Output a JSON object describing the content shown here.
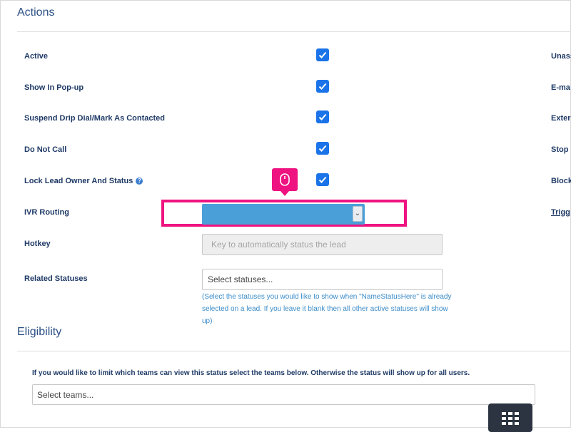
{
  "sections": {
    "actions_title": "Actions",
    "eligibility_title": "Eligibility"
  },
  "rows": {
    "active": "Active",
    "show_in_popup": "Show In Pop-up",
    "suspend_drip": "Suspend Drip Dial/Mark As Contacted",
    "do_not_call": "Do Not Call",
    "lock_lead_owner": "Lock Lead Owner And Status",
    "ivr_routing": "IVR Routing",
    "hotkey": "Hotkey",
    "related_statuses": "Related Statuses"
  },
  "checkboxes": {
    "active": true,
    "show_in_popup": true,
    "suspend_drip": true,
    "do_not_call": true,
    "lock_lead_owner": true
  },
  "right_column": {
    "row1": "Unass",
    "row2": "E-ma",
    "row3": "Exter",
    "row4": "Stop l",
    "row5": "Block",
    "row6": "Trigg"
  },
  "ivr_select": {
    "value": ""
  },
  "hotkey_input": {
    "placeholder": "Key to automatically status the lead"
  },
  "related_statuses_input": {
    "placeholder": "Select statuses..."
  },
  "related_statuses_help": "(Select the statuses you would like to show when \"NameStatusHere\" is already selected on a lead. If you leave it blank then all other active statuses will show up)",
  "eligibility": {
    "note": "If you would like to limit which teams can view this status select the teams below. Otherwise the status will show up for all users.",
    "teams_placeholder": "Select teams..."
  },
  "icons": {
    "help": "question-circle-icon",
    "checkbox": "checkmark-icon",
    "select_arrow": "chevron-down-icon",
    "mouse": "mouse-icon",
    "keypad": "keypad-grid-icon"
  },
  "colors": {
    "highlight": "#ee1380",
    "checkbox": "#1a73e8",
    "select_fill": "#4a9fd8",
    "help_text": "#3b8cc9"
  }
}
